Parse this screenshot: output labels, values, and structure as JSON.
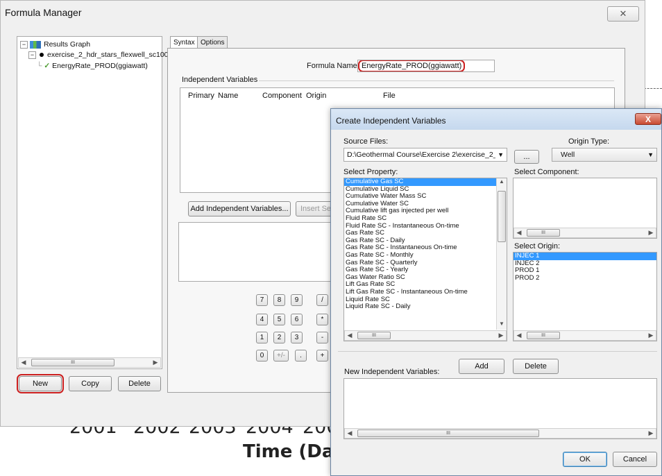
{
  "background_chart": {
    "years": [
      "2001",
      "2002",
      "2003",
      "2004",
      "200"
    ],
    "xlabel_partial": "Time (Dat"
  },
  "formula_manager": {
    "title": "Formula Manager",
    "close_glyph": "✕",
    "tree": {
      "root_label": "Results Graph",
      "child_label": "exercise_2_hdr_stars_flexwell_sc100.",
      "grandchild_label": "EnergyRate_PROD(ggiawatt)"
    },
    "buttons": {
      "new": "New",
      "copy": "Copy",
      "delete": "Delete"
    },
    "tabs": [
      "Syntax",
      "Options"
    ],
    "formula_name_label": "Formula Name:",
    "formula_name_value": "EnergyRate_PROD(ggiawatt)",
    "independent_variables_label": "Independent Variables",
    "iv_columns": [
      "Primary",
      "Name",
      "Component",
      "Origin",
      "File"
    ],
    "add_iv_button": "Add Independent Variables...",
    "insert_button_partial": "Insert Se",
    "calc_keys": [
      "7",
      "8",
      "9",
      "/",
      "4",
      "5",
      "6",
      "*",
      "1",
      "2",
      "3",
      "-",
      "0",
      "+/-",
      ".",
      "+"
    ]
  },
  "dialog": {
    "title": "Create Independent Variables",
    "close_glyph": "X",
    "source_files_label": "Source Files:",
    "source_file_value": "D:\\Geothermal Course\\Exercise 2\\exercise_2_h",
    "browse_label": "...",
    "origin_type_label": "Origin Type:",
    "origin_type_value": "Well",
    "select_property_label": "Select Property:",
    "select_component_label": "Select Component:",
    "select_origin_label": "Select Origin:",
    "properties": [
      "Cumulative Gas SC",
      "Cumulative Liquid SC",
      "Cumulative Water Mass SC",
      "Cumulative Water SC",
      "Cumulative lift gas injected per well",
      "Fluid Rate SC",
      "Fluid Rate SC - Instantaneous On-time",
      "Gas Rate SC",
      "Gas Rate SC - Daily",
      "Gas Rate SC - Instantaneous On-time",
      "Gas Rate SC - Monthly",
      "Gas Rate SC - Quarterly",
      "Gas Rate SC - Yearly",
      "Gas Water Ratio SC",
      "Lift Gas Rate SC",
      "Lift Gas Rate SC - Instantaneous On-time",
      "Liquid Rate SC",
      "Liquid Rate SC - Daily"
    ],
    "selected_property": "Cumulative Gas SC",
    "origins": [
      "INJEC 1",
      "INJEC 2",
      "PROD 1",
      "PROD 2"
    ],
    "selected_origin": "INJEC 1",
    "new_iv_label": "New Independent Variables:",
    "add_button": "Add",
    "delete_button": "Delete",
    "ok_button": "OK",
    "cancel_button": "Cancel",
    "scroll_thumb_glyph": "III"
  }
}
